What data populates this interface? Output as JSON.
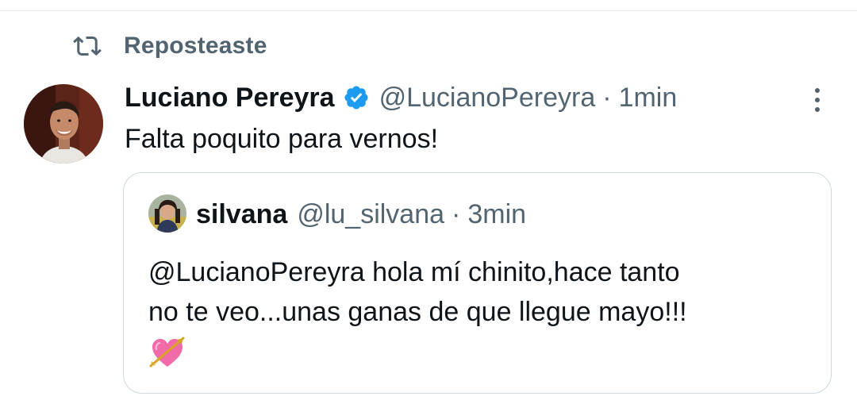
{
  "repost": {
    "label": "Reposteaste",
    "icon": "repost-icon"
  },
  "tweet": {
    "display_name": "Luciano Pereyra",
    "verified_icon": "verified-badge-icon",
    "handle": "@LucianoPereyra",
    "separator": "·",
    "time": "1min",
    "text": "Falta poquito para vernos!",
    "more_icon": "more-options-icon"
  },
  "quote": {
    "display_name": "silvana",
    "handle": "@lu_silvana",
    "separator": "·",
    "time": "3min",
    "lines": [
      "@LucianoPereyra hola mí chinito,hace tanto",
      "no te veo...unas ganas de que llegue mayo!!!"
    ],
    "emoji_icon": "heart-with-arrow-emoji"
  },
  "colors": {
    "text_primary": "#0f1419",
    "text_secondary": "#536471",
    "verified_blue": "#1d9bf0",
    "border": "#cfd9de",
    "emoji_pink": "#f06ba8"
  }
}
